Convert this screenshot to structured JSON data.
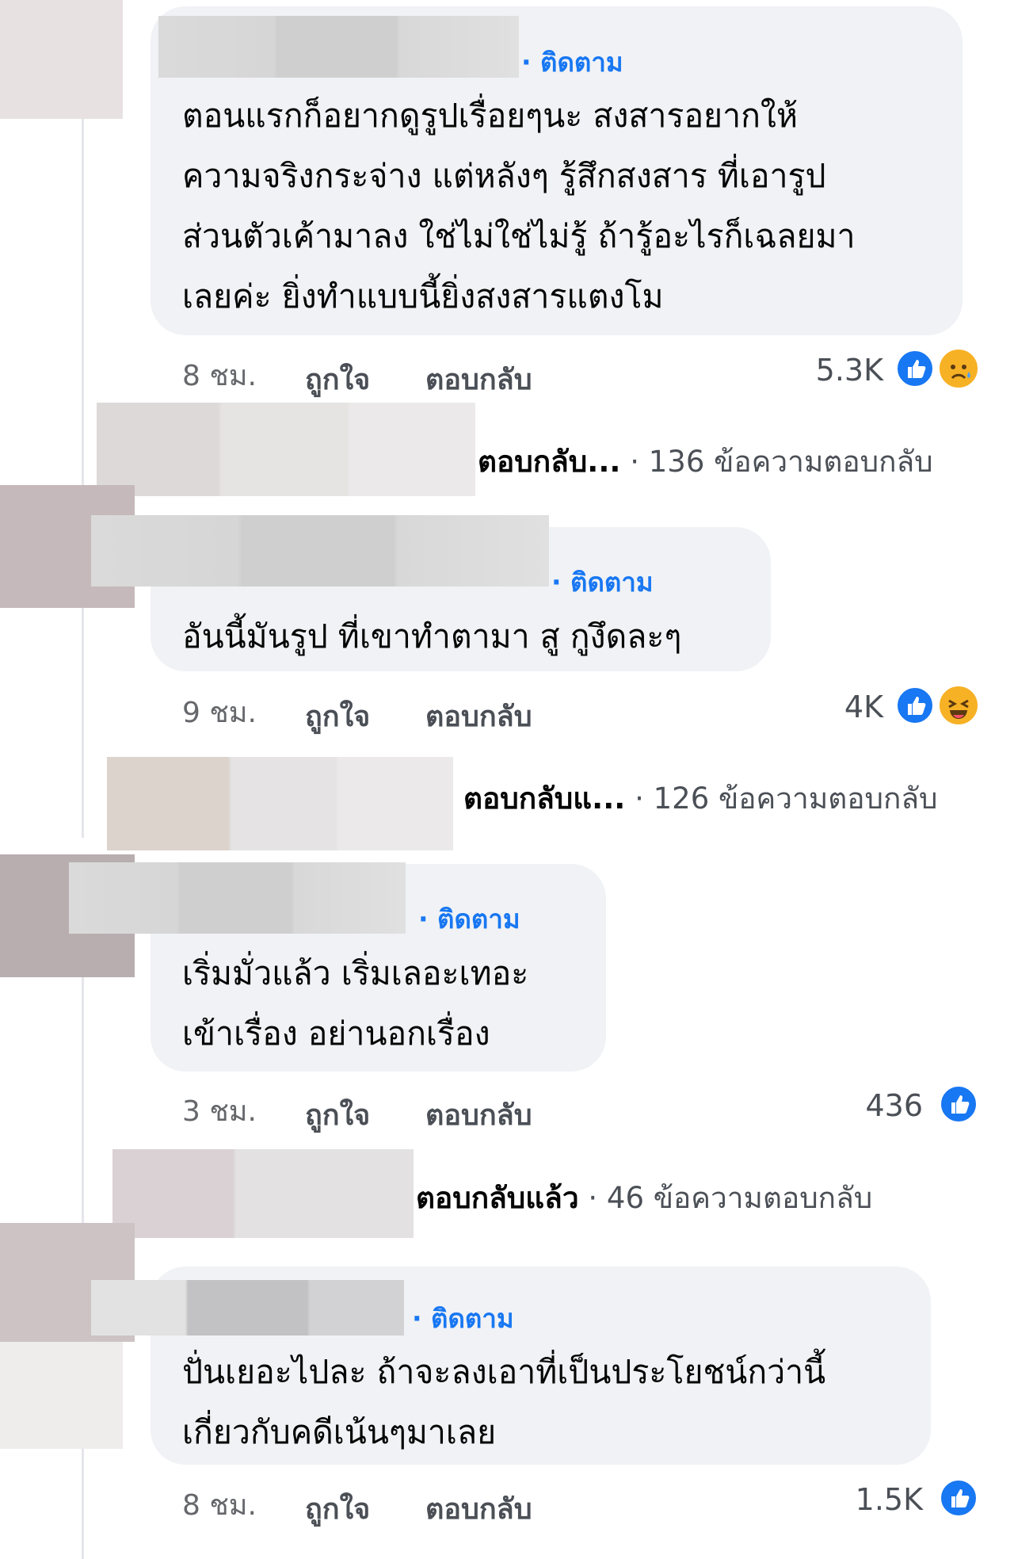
{
  "comments": [
    {
      "follow_label": "· ติดตาม",
      "text": "ตอนแรกก็อยากดูรูปเรื่อยๆนะ สงสารอยากให้\nความจริงกระจ่าง แต่หลังๆ รู้สึกสงสาร ที่เอารูป\nส่วนตัวเค้ามาลง ใช่ไม่ใช่ไม่รู้ ถ้ารู้อะไรก็เฉลยมา\nเลยค่ะ ยิ่งทำแบบนี้ยิ่งสงสารแตงโม",
      "time": "8 ชม.",
      "like_label": "ถูกใจ",
      "reply_label": "ตอบกลับ",
      "reaction_count": "5.3K",
      "reactions": [
        "like-icon",
        "sad-icon"
      ],
      "reply_summary": {
        "lead": "ตอบกลับ...",
        "count_text": "· 136 ข้อความตอบกลับ"
      }
    },
    {
      "follow_label": "· ติดตาม",
      "text": "อันนี้มันรูป ที่เขาทำตามา สู กูงึดละๆ",
      "time": "9 ชม.",
      "like_label": "ถูกใจ",
      "reply_label": "ตอบกลับ",
      "reaction_count": "4K",
      "reactions": [
        "like-icon",
        "haha-icon"
      ],
      "reply_summary": {
        "lead": "ตอบกลับแ...",
        "count_text": "· 126 ข้อความตอบกลับ"
      }
    },
    {
      "follow_label": "· ติดตาม",
      "text": "เริ่มมั่วแล้ว  เริ่มเลอะเทอะ\nเข้าเรื่อง อย่านอกเรื่อง",
      "time": "3 ชม.",
      "like_label": "ถูกใจ",
      "reply_label": "ตอบกลับ",
      "reaction_count": "436",
      "reactions": [
        "like-icon"
      ],
      "reply_summary": {
        "lead": "ตอบกลับแล้ว",
        "count_text": "· 46 ข้อความตอบกลับ"
      }
    },
    {
      "follow_label": "· ติดตาม",
      "text": "ปั่นเยอะไปละ ถ้าจะลงเอาที่เป็นประโยชน์กว่านี้\nเกี่ยวกับคดีเน้นๆมาเลย",
      "time": "8 ชม.",
      "like_label": "ถูกใจ",
      "reply_label": "ตอบกลับ",
      "reaction_count": "1.5K",
      "reactions": [
        "like-icon"
      ]
    }
  ],
  "colors": {
    "link": "#1877f2",
    "bubble": "#f0f2f5",
    "meta": "#65676b"
  }
}
